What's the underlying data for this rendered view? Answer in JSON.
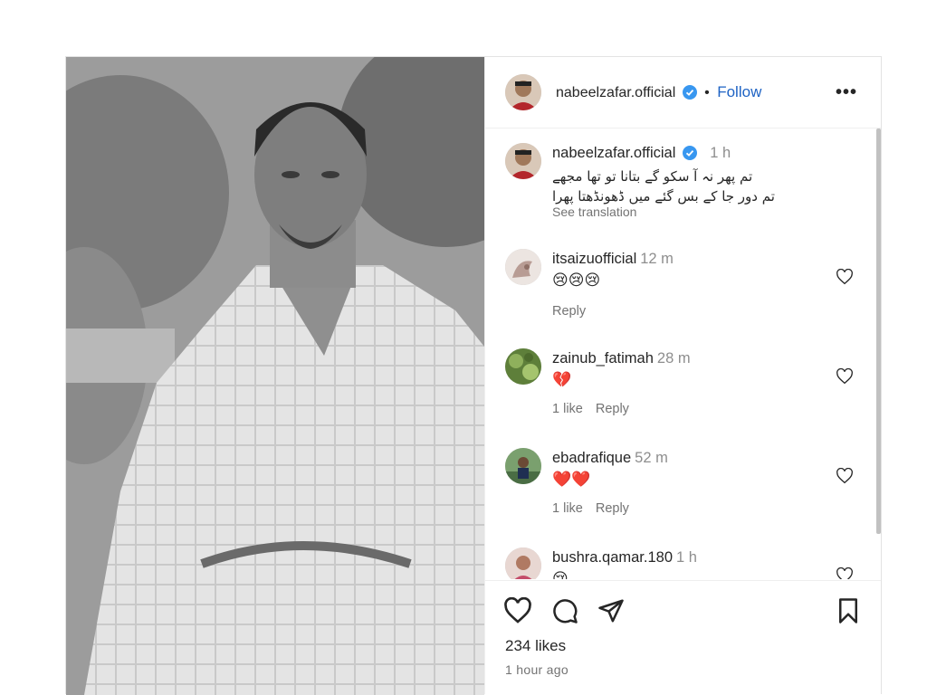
{
  "header": {
    "username": "nabeelzafar.official",
    "separator": "•",
    "follow_label": "Follow",
    "more_label": "•••"
  },
  "caption": {
    "username": "nabeelzafar.official",
    "time": "1 h",
    "line1": "تم پھر نہ آ سکو گے بتانا تو تھا مجھے",
    "line2": "تم دور جا کے بس گئے میں ڈھونڈھتا پھرا",
    "see_translation": "See translation"
  },
  "comments": [
    {
      "username": "itsaizuofficial",
      "time": "12 m",
      "text": "😢😢😢",
      "likes": "",
      "reply": "Reply"
    },
    {
      "username": "zainub_fatimah",
      "time": "28 m",
      "text": "💔",
      "likes": "1 like",
      "reply": "Reply"
    },
    {
      "username": "ebadrafique",
      "time": "52 m",
      "text": "❤️❤️",
      "likes": "1 like",
      "reply": "Reply"
    },
    {
      "username": "bushra.qamar.180",
      "time": "1 h",
      "text": "😢",
      "likes": "",
      "reply": ""
    }
  ],
  "footer": {
    "likes": "234 likes",
    "time_ago": "1 hour ago"
  },
  "colors": {
    "accent": "#1e63c4",
    "verified": "#3897f0"
  },
  "icons": [
    "heart-icon",
    "comment-icon",
    "share-icon",
    "bookmark-icon",
    "verified-badge-icon",
    "more-icon"
  ]
}
